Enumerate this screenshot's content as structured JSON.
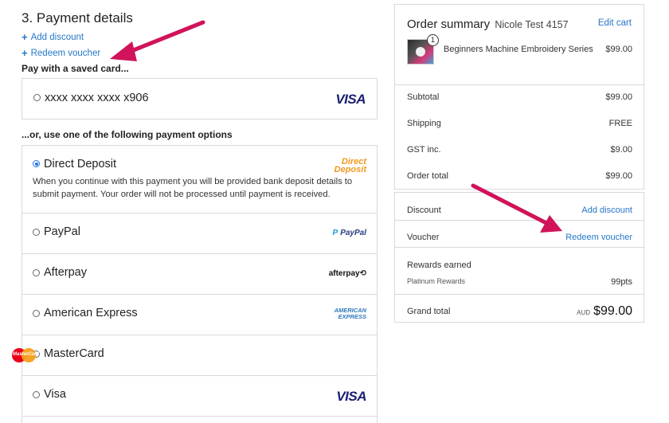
{
  "payment": {
    "heading": "3. Payment details",
    "add_discount": "Add discount",
    "redeem_voucher": "Redeem voucher",
    "saved_card_label": "Pay with a saved card...",
    "saved_card_number": "xxxx xxxx xxxx x906",
    "or_label_prefix": "...or",
    "or_label_rest": ", use one of the following payment options",
    "options": [
      {
        "label": "Direct Deposit",
        "selected": true,
        "desc": "When you continue with this payment you will be provided bank deposit details to submit payment. Your order will not be processed until payment is received.",
        "logo_line1": "Direct",
        "logo_line2": "Deposit"
      },
      {
        "label": "PayPal",
        "selected": false,
        "logo": "PayPal"
      },
      {
        "label": "Afterpay",
        "selected": false,
        "logo": "afterpay"
      },
      {
        "label": "American Express",
        "selected": false,
        "logo_line1": "AMERICAN",
        "logo_line2": "EXPRESS"
      },
      {
        "label": "MasterCard",
        "selected": false,
        "logo": "MasterCard"
      },
      {
        "label": "Visa",
        "selected": false,
        "logo": "VISA"
      }
    ],
    "visa_logo": "VISA"
  },
  "summary": {
    "title": "Order summary",
    "user": "Nicole Test 4157",
    "edit_cart": "Edit cart",
    "item_qty": "1",
    "item_name": "Beginners Machine Embroidery Series",
    "item_price": "$99.00",
    "rows": [
      {
        "label": "Subtotal",
        "value": "$99.00"
      },
      {
        "label": "Shipping",
        "value": "FREE"
      },
      {
        "label": "GST inc.",
        "value": "$9.00"
      },
      {
        "label": "Order total",
        "value": "$99.00"
      }
    ],
    "discount_label": "Discount",
    "discount_link": "Add discount",
    "voucher_label": "Voucher",
    "voucher_link": "Redeem voucher",
    "rewards_label": "Rewards earned",
    "rewards_tier": "Platinum Rewards",
    "rewards_value": "99pts",
    "grand_total_label": "Grand total",
    "grand_total_currency": "AUD",
    "grand_total_value": "$99.00"
  },
  "colors": {
    "link": "#2677c8",
    "arrow": "#d0135a",
    "radio_selected": "#1a73e8"
  }
}
